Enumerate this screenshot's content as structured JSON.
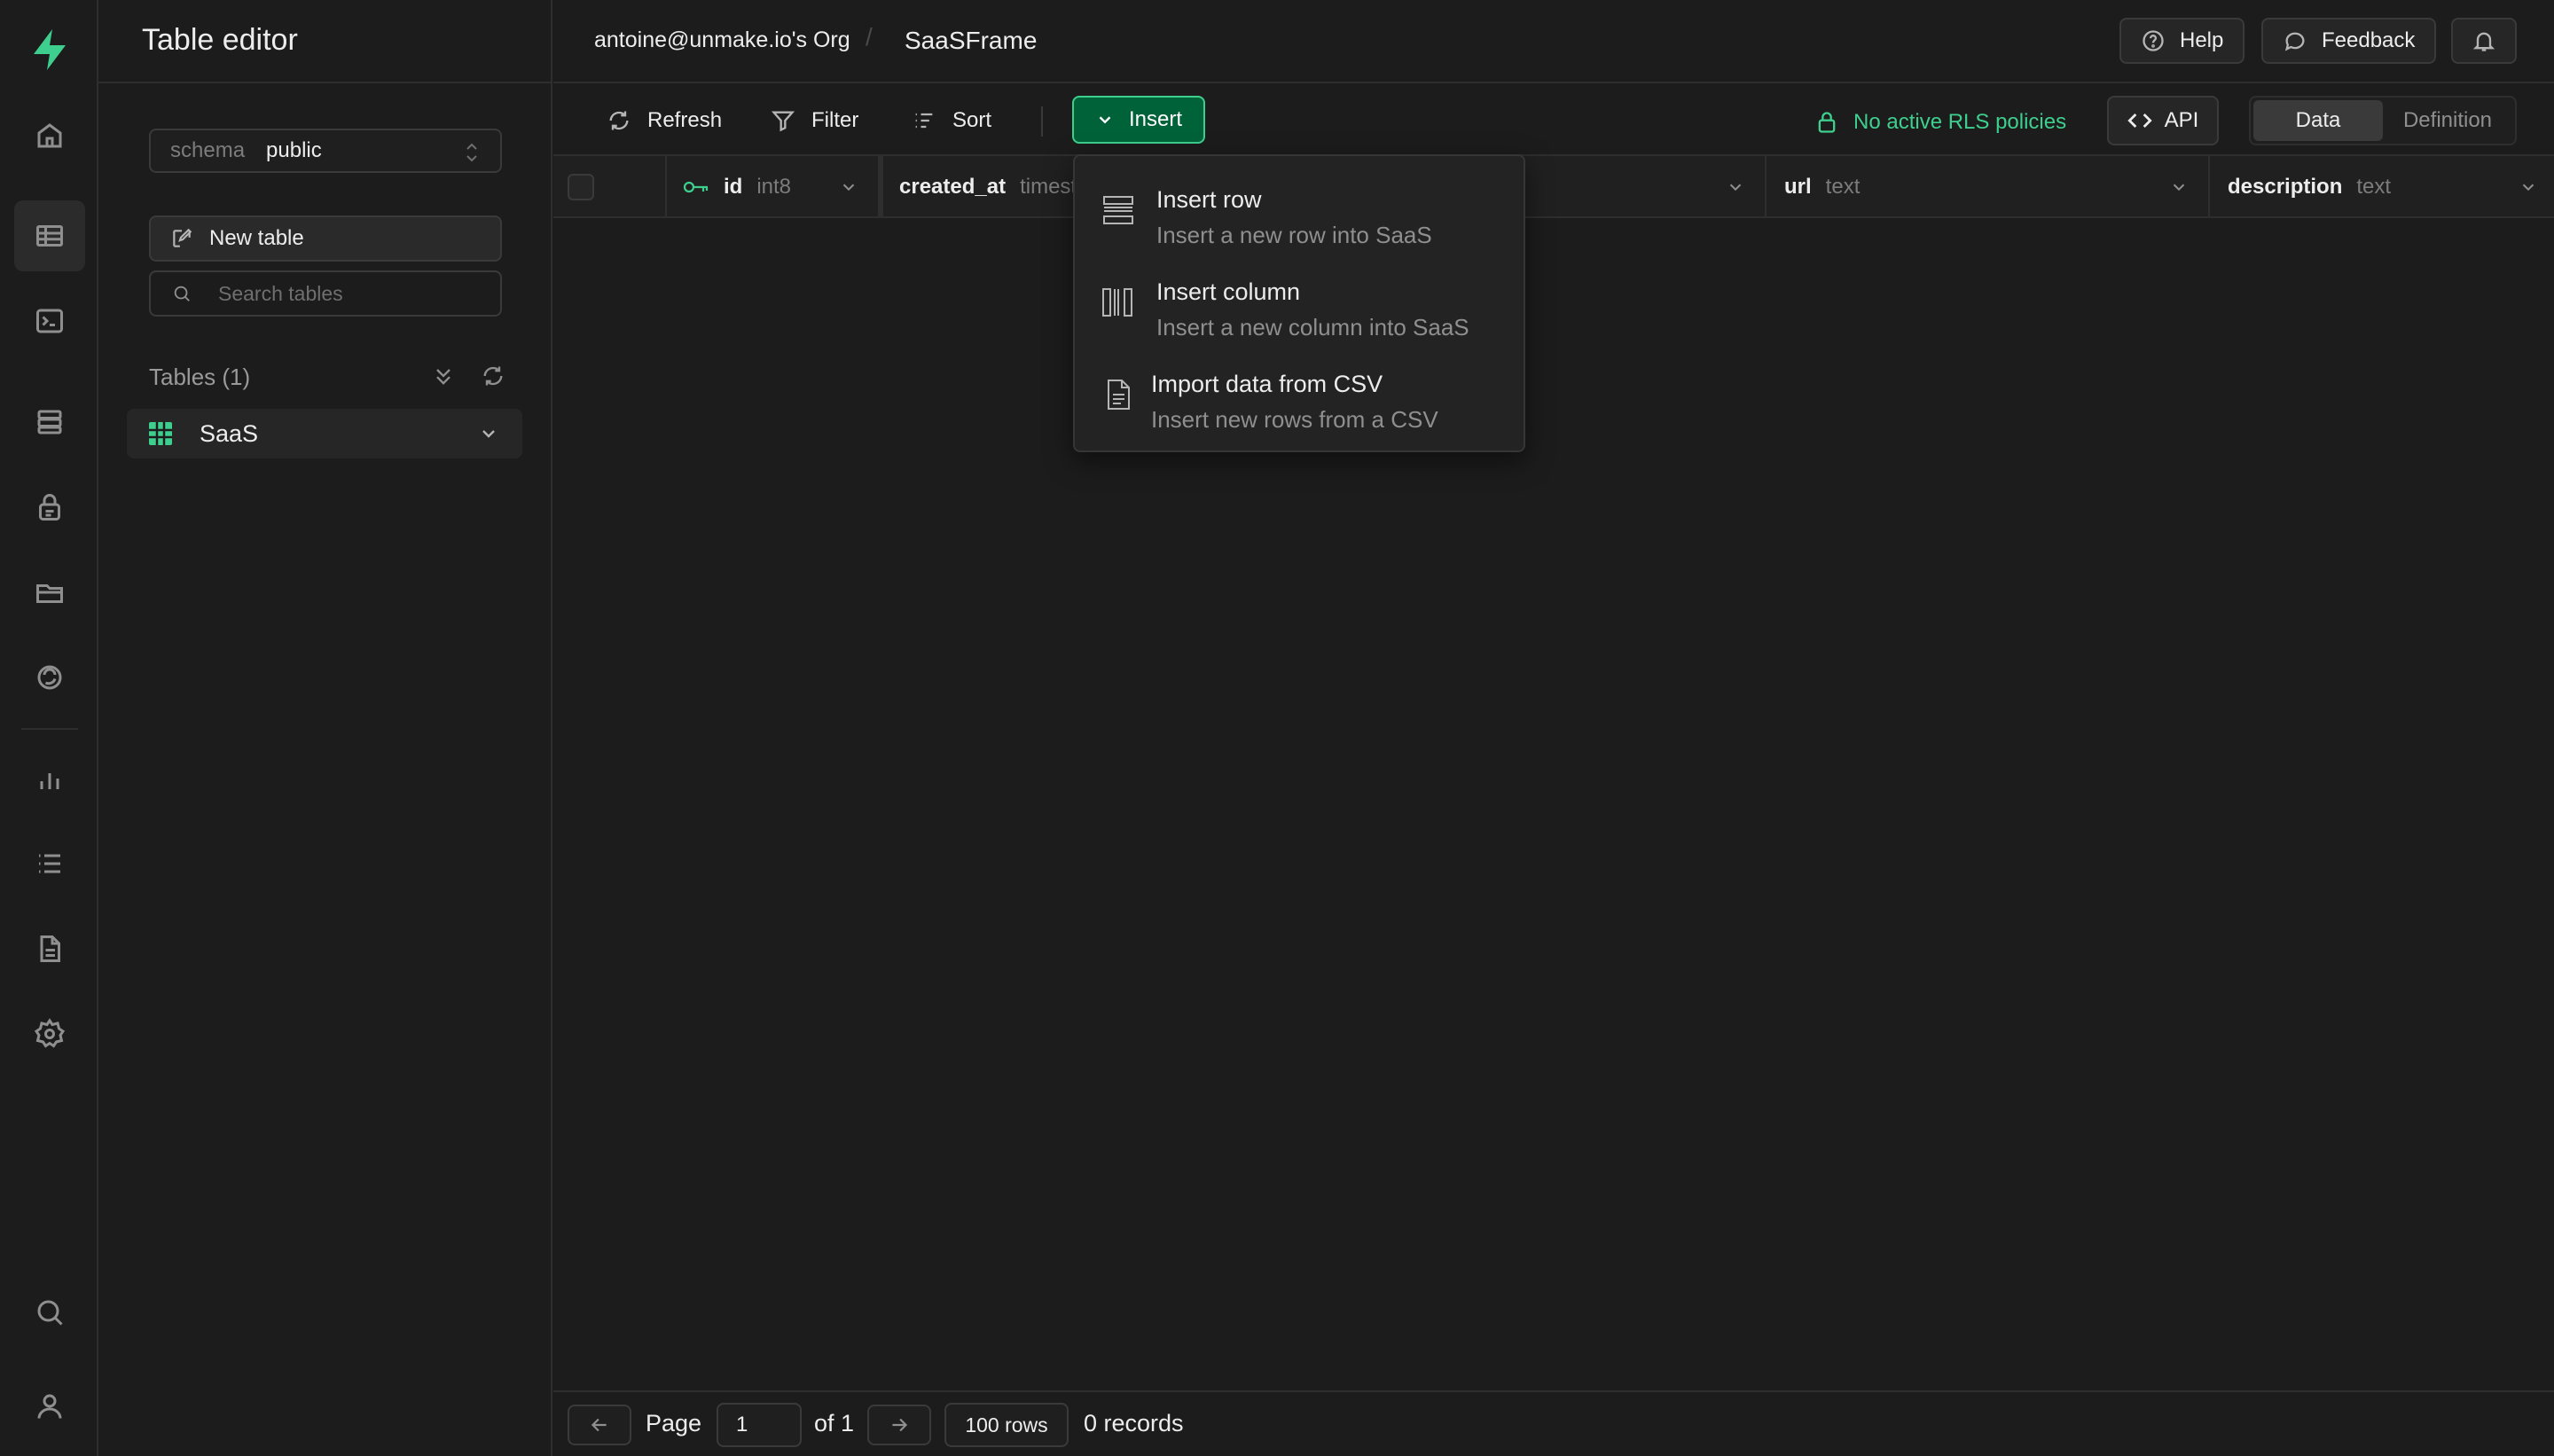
{
  "sidebar": {
    "title": "Table editor",
    "schema": {
      "label": "schema",
      "value": "public"
    },
    "new_table_label": "New table",
    "search_placeholder": "Search tables",
    "tables_heading": "Tables (1)",
    "tables": [
      {
        "name": "SaaS"
      }
    ]
  },
  "topbar": {
    "org": "antoine@unmake.io's Org",
    "separator": "/",
    "project": "SaaSFrame",
    "help_label": "Help",
    "feedback_label": "Feedback"
  },
  "toolbar": {
    "refresh_label": "Refresh",
    "filter_label": "Filter",
    "sort_label": "Sort",
    "insert_label": "Insert",
    "rls_label": "No active RLS policies",
    "api_label": "API",
    "view_tabs": [
      "Data",
      "Definition"
    ],
    "active_view": "Data"
  },
  "columns": [
    {
      "name": "id",
      "type": "int8",
      "primary_key": true
    },
    {
      "name": "created_at",
      "type": "timest"
    },
    {
      "name": "url",
      "type": "text"
    },
    {
      "name": "description",
      "type": "text"
    }
  ],
  "insert_menu": [
    {
      "title": "Insert row",
      "desc": "Insert a new row into SaaS",
      "icon": "rows-icon"
    },
    {
      "title": "Insert column",
      "desc": "Insert a new column into SaaS",
      "icon": "columns-icon"
    },
    {
      "title": "Import data from CSV",
      "desc": "Insert new rows from a CSV",
      "icon": "file-icon"
    }
  ],
  "footer": {
    "page_label": "Page",
    "page_value": "1",
    "of_label": "of 1",
    "rows_label": "100 rows",
    "records_label": "0 records"
  },
  "colors": {
    "accent": "#3ecf8e",
    "accent_dark": "#006239",
    "background": "#1c1c1c"
  }
}
